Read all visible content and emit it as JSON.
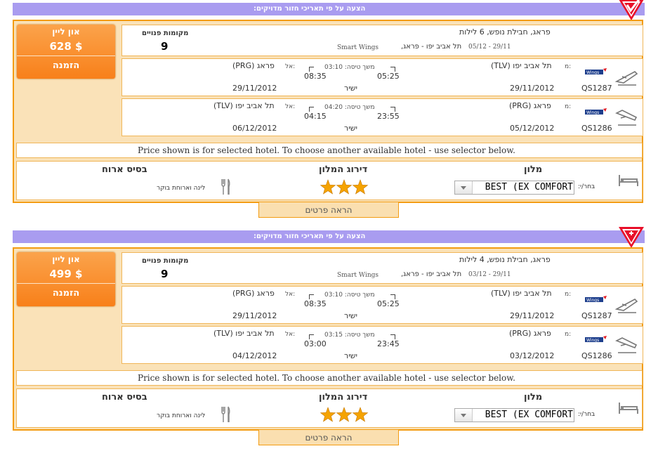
{
  "offers": [
    {
      "banner": "הצעה על פי תאריכי חזור מדויקים:",
      "corner_icon": "check-icon",
      "price": {
        "online_label": "און ליין",
        "amount": "628 $",
        "book_label": "הזמנה"
      },
      "summary": {
        "title": "פראג, חבילת נופש,",
        "nights": "6 לילות",
        "route": "תל אביב יפו  -  פראג,",
        "dates": "05/12 - 29/11",
        "airline": "Smart Wings",
        "seats_label": "מקומות פנויים",
        "seats": "9"
      },
      "flights": [
        {
          "flight_no": "QS1287",
          "from_label": "מ:",
          "from": "תל אביב יפו (TLV)",
          "to_label": "אל:",
          "to": "פראג (PRG)",
          "dep_time": "05:25",
          "arr_time": "08:35",
          "duration": "משך טיסה: 03:10",
          "dep_date": "29/11/2012",
          "arr_date": "29/11/2012",
          "type": "ישיר"
        },
        {
          "flight_no": "QS1286",
          "from_label": "מ:",
          "from": "פראג (PRG)",
          "to_label": "אל:",
          "to": "תל אביב יפו (TLV)",
          "dep_time": "23:55",
          "arr_time": "04:15",
          "duration": "משך טיסה: 04:20",
          "dep_date": "05/12/2012",
          "arr_date": "06/12/2012",
          "type": "ישיר"
        }
      ],
      "note": "Price shown is for selected hotel. To choose another available hotel - use selector below.",
      "hotel": {
        "hotel_header": "מלון",
        "rating_header": "דירוג המלון",
        "board_header": "בסיס ארוח",
        "choose_label": "בחר/י:",
        "selected_hotel": "BEST (EX  COMFORT",
        "stars": 3,
        "board": "לינה וארוחת בוקר"
      },
      "details_label": "הראה פרטים"
    },
    {
      "banner": "הצעה על פי תאריכי חזור מדויקים:",
      "corner_icon": "plus-icon",
      "price": {
        "online_label": "און ליין",
        "amount": "499 $",
        "book_label": "הזמנה"
      },
      "summary": {
        "title": "פראג, חבילת נופש,",
        "nights": "4 לילות",
        "route": "תל אביב יפו  -  פראג,",
        "dates": "03/12 - 29/11",
        "airline": "Smart Wings",
        "seats_label": "מקומות פנויים",
        "seats": "9"
      },
      "flights": [
        {
          "flight_no": "QS1287",
          "from_label": "מ:",
          "from": "תל אביב יפו (TLV)",
          "to_label": "אל:",
          "to": "פראג (PRG)",
          "dep_time": "05:25",
          "arr_time": "08:35",
          "duration": "משך טיסה: 03:10",
          "dep_date": "29/11/2012",
          "arr_date": "29/11/2012",
          "type": "ישיר"
        },
        {
          "flight_no": "QS1286",
          "from_label": "מ:",
          "from": "פראג (PRG)",
          "to_label": "אל:",
          "to": "תל אביב יפו (TLV)",
          "dep_time": "23:45",
          "arr_time": "03:00",
          "duration": "משך טיסה: 03:15",
          "dep_date": "03/12/2012",
          "arr_date": "04/12/2012",
          "type": "ישיר"
        }
      ],
      "note": "Price shown is for selected hotel. To choose another available hotel - use selector below.",
      "hotel": {
        "hotel_header": "מלון",
        "rating_header": "דירוג המלון",
        "board_header": "בסיס ארוח",
        "choose_label": "בחר/י:",
        "selected_hotel": "BEST (EX  COMFORT",
        "stars": 3,
        "board": "לינה וארוחת בוקר"
      },
      "details_label": "הראה פרטים"
    }
  ],
  "colors": {
    "banner": "#a99cf0",
    "accent_orange": "#f39c12",
    "card_bg": "#fae2b8",
    "button": "#f8801a",
    "star": "#f5a300",
    "corner_red": "#e8102a"
  }
}
